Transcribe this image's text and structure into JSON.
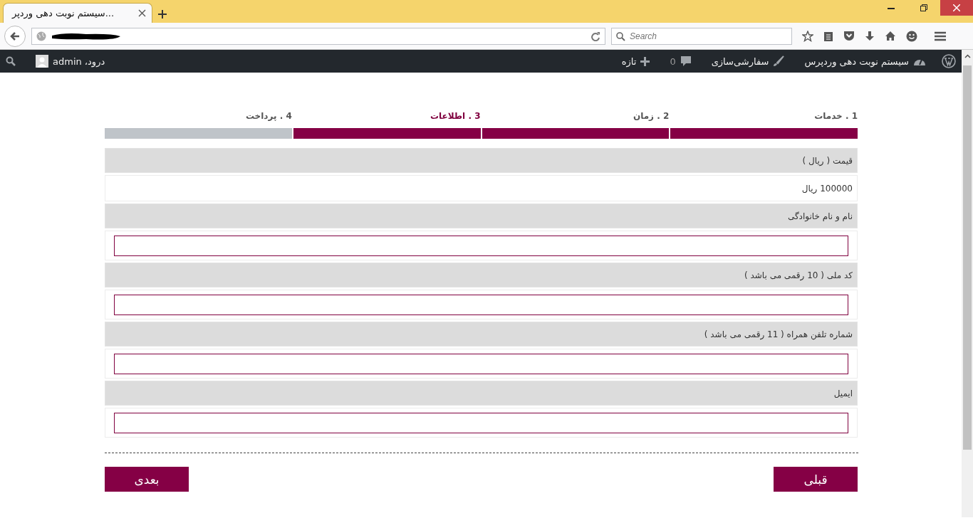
{
  "browser": {
    "tab_title": "سیستم نوبت دهی وردپر...",
    "search_placeholder": "Search"
  },
  "admin_bar": {
    "site_name": "سیستم نوبت دهی وردپرس",
    "customize": "سفارشی‌سازی",
    "comments_count": "0",
    "new": "تازه",
    "greeting": "درود، admin"
  },
  "steps": [
    {
      "label": "1 . خدمات",
      "completed": true,
      "selected": false
    },
    {
      "label": "2 . زمان",
      "completed": true,
      "selected": false
    },
    {
      "label": "3 . اطلاعات",
      "completed": true,
      "selected": true
    },
    {
      "label": "4 . پرداخت",
      "completed": false,
      "selected": false
    }
  ],
  "form": [
    {
      "kind": "display",
      "label": "قیمت ( ریال )",
      "value": "100000 ریال"
    },
    {
      "kind": "input",
      "label": "نام و نام خانوادگی"
    },
    {
      "kind": "input",
      "label": "کد ملی ( 10 رقمی می باشد )"
    },
    {
      "kind": "input",
      "label": "شماره تلفن همراه ( 11 رقمی می باشد )"
    },
    {
      "kind": "input",
      "label": "ایمیل"
    }
  ],
  "buttons": {
    "previous": "قبلی",
    "next": "بعدی"
  }
}
